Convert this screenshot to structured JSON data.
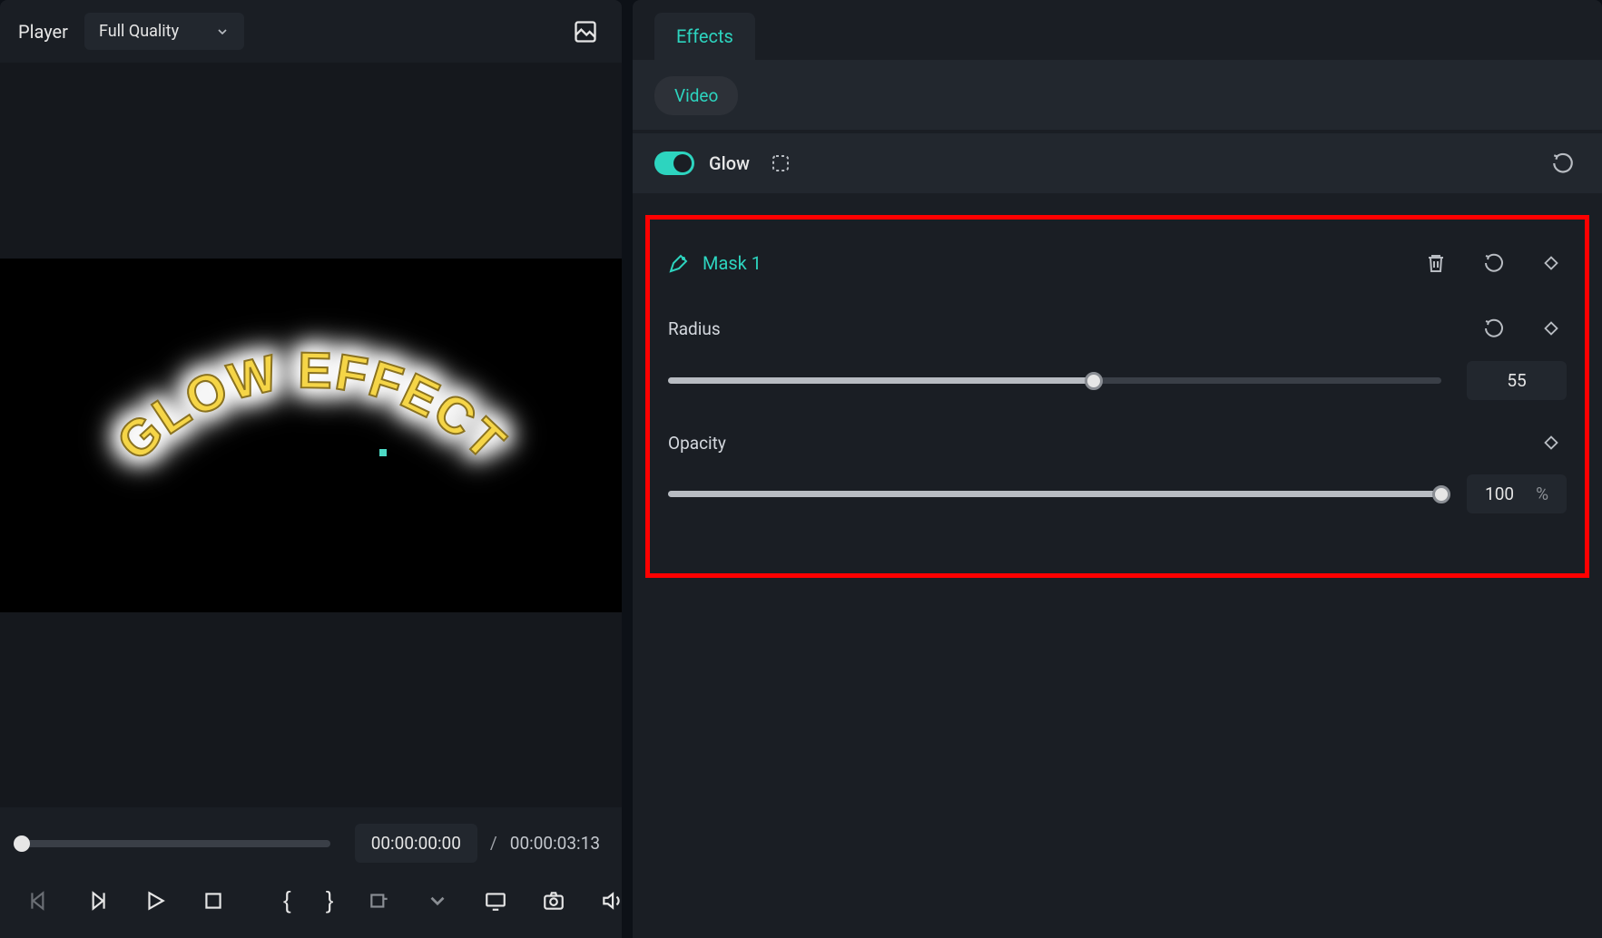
{
  "player": {
    "title": "Player",
    "quality": "Full Quality",
    "time_current": "00:00:00:00",
    "time_sep": "/",
    "time_total": "00:00:03:13",
    "preview_text": "GLOW EFFECT"
  },
  "effects": {
    "tab": "Effects",
    "sub_tab": "Video",
    "effect_name": "Glow",
    "mask": {
      "title": "Mask 1",
      "radius": {
        "label": "Radius",
        "value": "55",
        "percent": 55
      },
      "opacity": {
        "label": "Opacity",
        "value": "100",
        "unit": "%",
        "percent": 100
      }
    }
  }
}
